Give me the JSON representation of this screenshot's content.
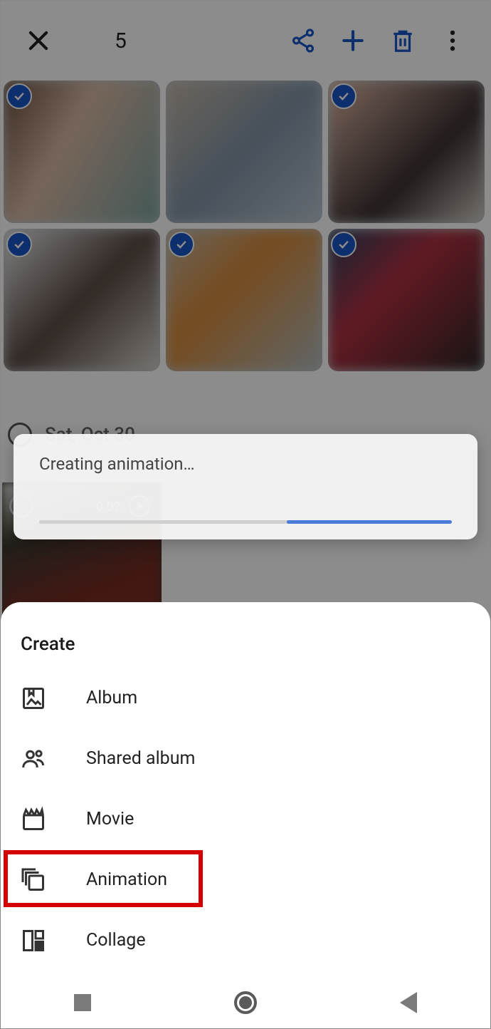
{
  "appbar": {
    "selection_count": "5"
  },
  "grid": {
    "date_label": "Sat, Oct 30",
    "video_duration": "0:02"
  },
  "toast": {
    "message": "Creating animation…"
  },
  "sheet": {
    "title": "Create",
    "items": [
      {
        "label": "Album"
      },
      {
        "label": "Shared album"
      },
      {
        "label": "Movie"
      },
      {
        "label": "Animation"
      },
      {
        "label": "Collage"
      }
    ]
  }
}
